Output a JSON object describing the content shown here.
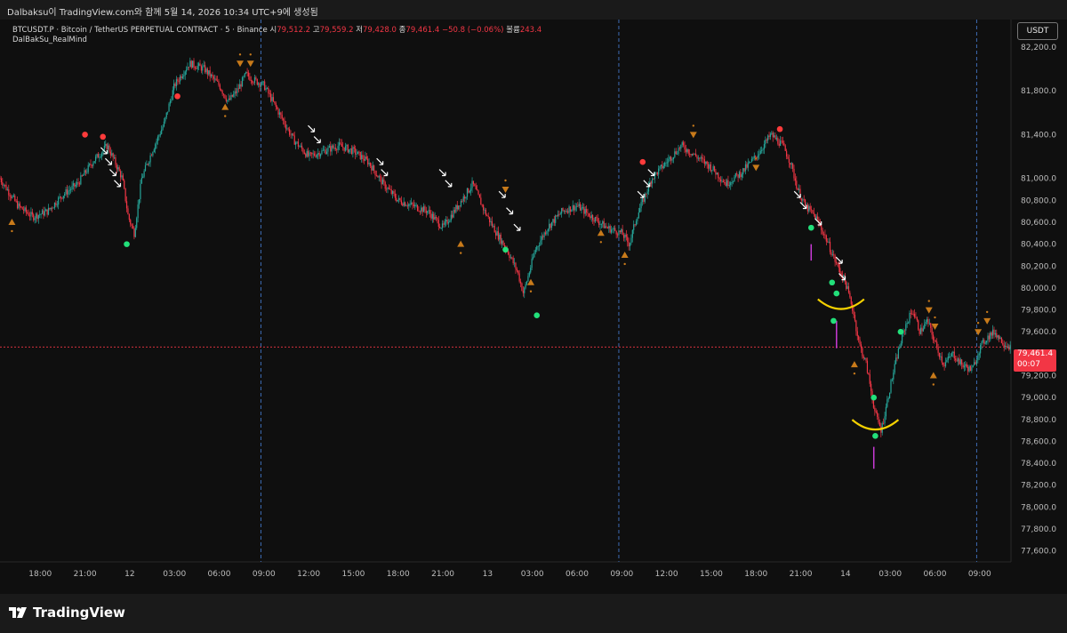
{
  "snapshot_caption": "Dalbaksu이 TradingView.com와 함께 5월 14, 2026 10:34 UTC+9에 생성됨",
  "legend": {
    "symbol": "BTCUSDT.P · Bitcoin / TetherUS PERPETUAL CONTRACT · 5 · Binance",
    "open_label": "시",
    "open": "79,512.2",
    "high_label": "고",
    "high": "79,559.2",
    "low_label": "저",
    "low": "79,428.0",
    "close_label": "종",
    "close": "79,461.4",
    "change": "−50.8 (−0.06%)",
    "volume_label": "볼륨",
    "volume": "243.4"
  },
  "indicator_name": "DalBakSu_RealMind",
  "currency_button": "USDT",
  "last_price": {
    "price": "79,461.4",
    "countdown": "00:07",
    "value": 79461.4
  },
  "brand": "TradingView",
  "colors": {
    "up": "#26a69a",
    "down": "#f23645",
    "background": "#0f0f0f",
    "session_line": "#3d6bb3",
    "signal_green": "#22e07a",
    "signal_red": "#ff3b3b",
    "triangle": "#c87a1a",
    "curve": "#f5d100",
    "volume_bar": "#c93ad6"
  },
  "chart_data": {
    "type": "candlestick",
    "title": "BTCUSDT.P 5m",
    "y_axis": {
      "ticks": [
        82200,
        81800,
        81400,
        81000,
        80800,
        80600,
        80400,
        80200,
        80000,
        79800,
        79600,
        79200,
        79000,
        78800,
        78600,
        78400,
        78200,
        78000,
        77800,
        77600
      ],
      "tick_labels": [
        "82,200.0",
        "81,800.0",
        "81,400.0",
        "81,000.0",
        "80,800.0",
        "80,600.0",
        "80,400.0",
        "80,200.0",
        "80,000.0",
        "79,800.0",
        "79,600.0",
        "79,200.0",
        "79,000.0",
        "78,800.0",
        "78,600.0",
        "78,400.0",
        "78,200.0",
        "78,000.0",
        "77,800.0",
        "77,600.0"
      ],
      "range": [
        77500,
        82450
      ]
    },
    "x_axis": {
      "labels": [
        "18:00",
        "21:00",
        "12",
        "03:00",
        "06:00",
        "09:00",
        "12:00",
        "15:00",
        "18:00",
        "21:00",
        "13",
        "03:00",
        "06:00",
        "09:00",
        "12:00",
        "15:00",
        "18:00",
        "21:00",
        "14",
        "03:00",
        "06:00",
        "09:00"
      ],
      "label_hours": [
        18,
        21,
        24,
        27,
        30,
        33,
        36,
        39,
        42,
        45,
        48,
        51,
        54,
        57,
        60,
        63,
        66,
        69,
        72,
        75,
        78,
        81
      ],
      "range_hours": [
        15.3,
        83.1
      ],
      "session_breaks_hours": [
        32.8,
        56.8,
        80.8
      ]
    },
    "price_path": [
      [
        15.3,
        81000
      ],
      [
        16.5,
        80750
      ],
      [
        17.5,
        80650
      ],
      [
        18.5,
        80700
      ],
      [
        19.5,
        80850
      ],
      [
        20.5,
        80950
      ],
      [
        21.5,
        81150
      ],
      [
        22.5,
        81300
      ],
      [
        23.0,
        81150
      ],
      [
        23.5,
        81000
      ],
      [
        23.9,
        80650
      ],
      [
        24.3,
        80500
      ],
      [
        24.8,
        81000
      ],
      [
        25.5,
        81250
      ],
      [
        26.3,
        81500
      ],
      [
        27.0,
        81850
      ],
      [
        28.0,
        82050
      ],
      [
        29.0,
        82000
      ],
      [
        30.0,
        81850
      ],
      [
        30.6,
        81700
      ],
      [
        31.2,
        81800
      ],
      [
        31.8,
        81950
      ],
      [
        32.3,
        81900
      ],
      [
        33.0,
        81850
      ],
      [
        34.0,
        81600
      ],
      [
        35.0,
        81350
      ],
      [
        36.0,
        81200
      ],
      [
        37.0,
        81250
      ],
      [
        38.0,
        81300
      ],
      [
        39.0,
        81250
      ],
      [
        40.0,
        81150
      ],
      [
        41.0,
        80950
      ],
      [
        42.0,
        80800
      ],
      [
        43.0,
        80750
      ],
      [
        44.0,
        80700
      ],
      [
        45.0,
        80550
      ],
      [
        46.0,
        80750
      ],
      [
        47.0,
        80950
      ],
      [
        47.8,
        80700
      ],
      [
        48.6,
        80500
      ],
      [
        49.3,
        80350
      ],
      [
        50.0,
        80150
      ],
      [
        50.4,
        79950
      ],
      [
        51.2,
        80350
      ],
      [
        52.0,
        80550
      ],
      [
        53.0,
        80700
      ],
      [
        54.0,
        80750
      ],
      [
        55.0,
        80650
      ],
      [
        56.0,
        80550
      ],
      [
        57.0,
        80500
      ],
      [
        57.5,
        80400
      ],
      [
        58.0,
        80650
      ],
      [
        59.0,
        81000
      ],
      [
        60.0,
        81150
      ],
      [
        61.0,
        81300
      ],
      [
        62.0,
        81200
      ],
      [
        63.0,
        81100
      ],
      [
        64.0,
        80950
      ],
      [
        65.0,
        81050
      ],
      [
        66.0,
        81200
      ],
      [
        67.0,
        81400
      ],
      [
        67.8,
        81300
      ],
      [
        68.3,
        81150
      ],
      [
        68.8,
        80900
      ],
      [
        69.3,
        80750
      ],
      [
        70.0,
        80650
      ],
      [
        70.7,
        80450
      ],
      [
        71.3,
        80250
      ],
      [
        72.0,
        80050
      ],
      [
        72.5,
        79800
      ],
      [
        72.9,
        79500
      ],
      [
        73.4,
        79300
      ],
      [
        74.0,
        78850
      ],
      [
        74.4,
        78700
      ],
      [
        75.0,
        79100
      ],
      [
        75.5,
        79400
      ],
      [
        76.0,
        79650
      ],
      [
        76.5,
        79800
      ],
      [
        77.0,
        79600
      ],
      [
        77.5,
        79700
      ],
      [
        78.0,
        79500
      ],
      [
        78.6,
        79300
      ],
      [
        79.2,
        79400
      ],
      [
        79.8,
        79300
      ],
      [
        80.5,
        79250
      ],
      [
        81.0,
        79450
      ],
      [
        81.5,
        79550
      ],
      [
        82.0,
        79600
      ],
      [
        82.6,
        79500
      ],
      [
        83.1,
        79461.4
      ]
    ],
    "buy_signals": [
      [
        23.8,
        80400
      ],
      [
        49.2,
        80350
      ],
      [
        51.3,
        79750
      ],
      [
        69.7,
        80550
      ],
      [
        71.1,
        80050
      ],
      [
        71.4,
        79950
      ],
      [
        71.2,
        79700
      ],
      [
        74.0,
        78650
      ],
      [
        73.9,
        79000
      ],
      [
        75.7,
        79600
      ]
    ],
    "sell_signals": [
      [
        21.0,
        81400
      ],
      [
        22.2,
        81380
      ],
      [
        27.2,
        81750
      ],
      [
        58.4,
        81150
      ],
      [
        67.6,
        81450
      ]
    ],
    "up_triangles": [
      [
        16.1,
        80600
      ],
      [
        30.4,
        81650
      ],
      [
        46.2,
        80400
      ],
      [
        50.9,
        80050
      ],
      [
        55.6,
        80500
      ],
      [
        57.2,
        80300
      ],
      [
        72.6,
        79300
      ],
      [
        77.9,
        79200
      ]
    ],
    "down_triangles": [
      [
        31.4,
        82050
      ],
      [
        32.1,
        82050
      ],
      [
        49.2,
        80900
      ],
      [
        61.8,
        81400
      ],
      [
        66.0,
        81100
      ],
      [
        77.6,
        79800
      ],
      [
        78.0,
        79650
      ],
      [
        80.9,
        79600
      ],
      [
        81.5,
        79700
      ]
    ],
    "curves": [
      [
        71.7,
        79800
      ],
      [
        74.0,
        78700
      ]
    ],
    "volume_spikes": [
      [
        69.7,
        80400,
        80250
      ],
      [
        71.4,
        79700,
        79450
      ],
      [
        73.9,
        78350,
        78550
      ]
    ]
  }
}
